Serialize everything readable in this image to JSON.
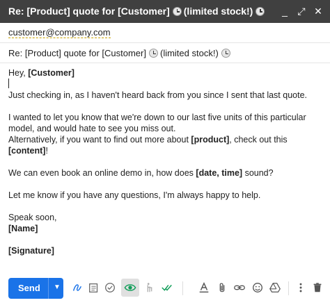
{
  "window": {
    "title_part1": "Re: [Product] quote for [Customer]",
    "title_part2": "(limited stock!)",
    "controls": [
      "_",
      "⤢",
      "✕"
    ]
  },
  "compose": {
    "to": "customer@company.com",
    "subject_part1": "Re: [Product] quote for [Customer]",
    "subject_part2": "(limited stock!)",
    "body": {
      "greeting_prefix": "Hey, ",
      "greeting_name": "[Customer]",
      "line1": "Just checking in, as I haven't heard back from you since I sent that last quote.",
      "line2": "I wanted to let you know that we're down to our last five units of this particular model, and would hate to see you miss out.",
      "line3_a": "Alternatively, if you want to find out more about ",
      "line3_b": "[product]",
      "line3_c": ", check out this ",
      "line3_d": "[content]",
      "line3_e": "!",
      "line4_a": "We can even book an online demo in, how does ",
      "line4_b": "[date, time]",
      "line4_c": " sound?",
      "line5": "Let me know if you have any questions, I'm always happy to help.",
      "signoff": "Speak soon,",
      "name": "[Name]",
      "signature": "[Signature]"
    }
  },
  "toolbar": {
    "send_label": "Send",
    "send_arrow": "▼",
    "accent_color": "#1a73e8",
    "icons": [
      "gesture-icon",
      "template-icon",
      "check-circle-icon",
      "eye-icon",
      "hand-icon",
      "double-check-icon",
      "format-text-icon",
      "attach-icon",
      "link-icon",
      "emoji-icon",
      "drive-icon",
      "more-vert-icon",
      "trash-icon"
    ]
  }
}
